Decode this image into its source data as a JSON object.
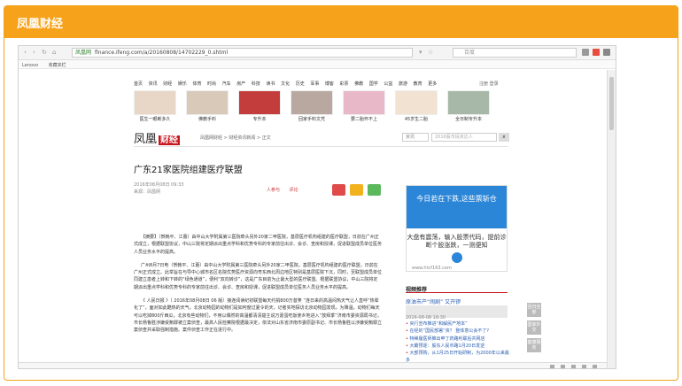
{
  "header": {
    "title": "凤凰财经"
  },
  "browser": {
    "url_tag": "凤凰网",
    "url": "finance.ifeng.com/a/20160808/14702229_0.shtml",
    "search_placeholder": "百度",
    "bookmarks": [
      "Lenovo",
      "收藏夹栏"
    ]
  },
  "site": {
    "top_nav": [
      "首页",
      "资讯",
      "财经",
      "娱乐",
      "体育",
      "时尚",
      "汽车",
      "房产",
      "科技",
      "读书",
      "文化",
      "历史",
      "军事",
      "博客",
      "彩票",
      "佛教",
      "国学",
      "公益",
      "旅游",
      "教育",
      "更多"
    ],
    "top_right": "注册 登录",
    "strip": [
      "医生一眼断多久",
      "佛教手料",
      "专升本",
      "回家手料文凭",
      "要二胎怀不上",
      "45岁生二胎",
      "全日制专升本"
    ],
    "logo_a": "凤凰",
    "logo_b": "财经",
    "breadcrumb": "凤凰网财经 > 财经资讯新闻 > 正文",
    "search_select": "资讯",
    "search_input": "2016股市投资达人"
  },
  "article": {
    "title": "广东21家医院组建医疗联盟",
    "date": "2016年08月08日 09:33",
    "source": "来源：凤凰网",
    "actions": [
      "人参与",
      "评论"
    ],
    "p1": "【摘要】（贺韩平、江蕾）由中山大学附属第三医院牵头另外20家二甲医院，基层医疗机构组建的医疗联盟，日前在广州正式成立，根据联盟协议，中山三院将定期派出重点学科和优势专科的专家前往出诊、会诊、查房和授课，促进联盟成员单位医务人员业务水平的提高。",
    "p2": "广州8月7日电（贺韩平、江蕾）由中山大学附属第三医院牵头另外20家二甲医院，基层医疗机构组建的医疗联盟，日前在广州正式成立。此举旨在与导中心城市名区名院优势医疗资源向粤东西北周边地区特别是基层医院下沉，同时，至联盟成员单位 同建立患者上转和下转的“绿色通道”，便利“双向转诊”，这是广东目前为止最大型的医疗联盟。根据联盟协议，中山三院将定期派出重点学科和优势专科的专家前往出诊、会诊、查房和授课，促进联盟成员单位医务人员业务水平的提高。",
    "p3": "《 人民日报 》（ 2016年08月08日 06 版）接连阅读纪初联盟每天约捐800万昔笑 “连日来的高温闷热天气让人直呼“热晕化了”，面对如此酷热的天气，北京动物园的动物们是如何度过夏令的天，记者实地探访北京动物园发现，为降温，动物们每天可以吃掉800斤西瓜，北京有些动物们，不用以偶然的高温都清清楚主说万嘉蛋吃饭使乡地进入“放拜季”济南市委资源局书记，市长杨鲁胜涉嫌受贿罪被立案侦查，最高人民检察院根据最决定，依法对山东省济南市委原副书记、市长杨鲁胜以涉嫌受贿罪立案侦查并采取强制措施。案件侦查工作正在进行中。"
  },
  "ad": {
    "top": "今日若在下跌,这些票斩仓",
    "mid": "大盘有震荡，输入股票代码，提前诊断个股涨跌，一测便知",
    "foot": "www.htcf163.com"
  },
  "sidebar": {
    "section": "视频推荐",
    "lead": "原油市产“闹剧” 又开锣",
    "lead_meta": "2016-08-08 18:30",
    "related": [
      "央行宣布推进“和解民产地本”",
      "在经的“国民部署”资？ 整体意公会不了?",
      "特稀履医师推出申丁药路利联后共网店",
      "大霸预逐：股东人民币路1月20日发逆",
      "大部预购，从1月25日开始研制，为2000年以来最多",
      "逐报：俄罗斯正在经济利马利中国石油市场",
      "中投集团进驻江苏团队后任推开发展回来来"
    ],
    "float": [
      "回归全部",
      "国家外交",
      "健康服务"
    ]
  },
  "colors": {
    "brand": "#f7a21b",
    "accent": "#c8161d",
    "link": "#2a5db0"
  }
}
